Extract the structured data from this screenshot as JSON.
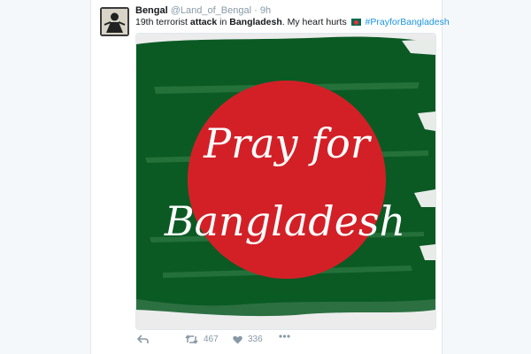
{
  "tweet": {
    "author_name": "Bengal",
    "handle": "@Land_of_Bengal",
    "separator": "·",
    "time": "9h",
    "text_part1": "19th terrorist ",
    "text_bold1": "attack",
    "text_part2": " in ",
    "text_bold2": "Bangladesh",
    "text_part3": ". My heart hurts",
    "hashtag": "#PrayforBangladesh",
    "flag_emoji": "flag-bangladesh-icon"
  },
  "media": {
    "line1": "Pray for",
    "line2": "Bangladesh",
    "flag_green": "#0b5a24",
    "circle_red": "#d32027"
  },
  "actions": {
    "retweet_count": "467",
    "like_count": "336",
    "reply_icon": "reply-icon",
    "retweet_icon": "retweet-icon",
    "like_icon": "heart-icon",
    "more_icon": "more-icon"
  },
  "colors": {
    "link": "#1b95e0",
    "muted": "#8899a6",
    "text": "#14171a"
  }
}
